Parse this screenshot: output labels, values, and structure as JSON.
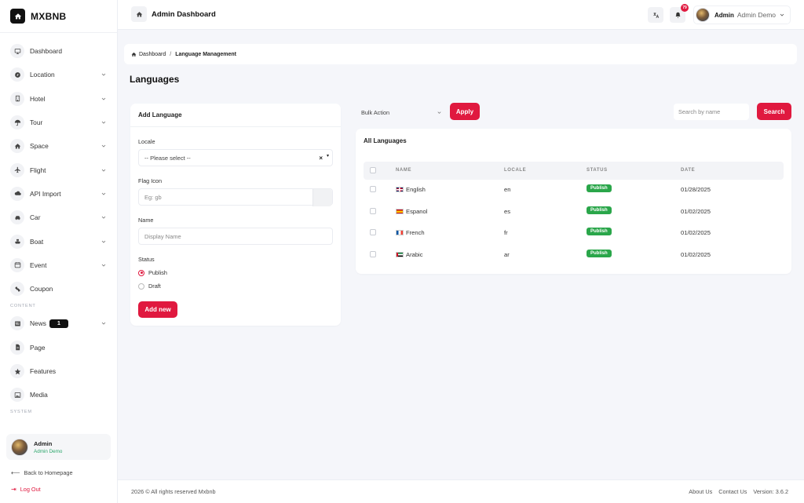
{
  "app": {
    "name": "MXBNB",
    "page_heading": "Admin Dashboard"
  },
  "sidebar": {
    "items": [
      {
        "label": "Dashboard",
        "icon": "monitor-icon",
        "has_sub": false
      },
      {
        "label": "Location",
        "icon": "compass-icon",
        "has_sub": true
      },
      {
        "label": "Hotel",
        "icon": "building-icon",
        "has_sub": true
      },
      {
        "label": "Tour",
        "icon": "umbrella-icon",
        "has_sub": true
      },
      {
        "label": "Space",
        "icon": "home-icon",
        "has_sub": true
      },
      {
        "label": "Flight",
        "icon": "plane-icon",
        "has_sub": true
      },
      {
        "label": "API Import",
        "icon": "cloud-icon",
        "has_sub": true
      },
      {
        "label": "Car",
        "icon": "car-icon",
        "has_sub": true
      },
      {
        "label": "Boat",
        "icon": "ship-icon",
        "has_sub": true
      },
      {
        "label": "Event",
        "icon": "calendar-icon",
        "has_sub": true
      },
      {
        "label": "Coupon",
        "icon": "ticket-icon",
        "has_sub": false
      }
    ],
    "content_section": "CONTENT",
    "content_items": [
      {
        "label": "News",
        "icon": "newspaper-icon",
        "has_sub": true,
        "badge": "1"
      },
      {
        "label": "Page",
        "icon": "file-icon",
        "has_sub": false
      },
      {
        "label": "Features",
        "icon": "star-icon",
        "has_sub": false
      },
      {
        "label": "Media",
        "icon": "image-icon",
        "has_sub": false
      }
    ],
    "system_section": "SYSTEM",
    "user": {
      "name": "Admin",
      "role": "Admin Demo"
    },
    "back_link": "Back to Homepage",
    "logout": "Log Out"
  },
  "topbar": {
    "notification_count": "79",
    "user_name": "Admin",
    "user_role": "Admin Demo"
  },
  "breadcrumb": {
    "root": "Dashboard",
    "current": "Language Management"
  },
  "page_title": "Languages",
  "form": {
    "title": "Add Language",
    "locale_label": "Locale",
    "locale_placeholder": "-- Please select --",
    "flag_label": "Flag Icon",
    "flag_placeholder": "Eg: gb",
    "name_label": "Name",
    "name_placeholder": "Display Name",
    "status_label": "Status",
    "status_options": [
      "Publish",
      "Draft"
    ],
    "status_selected": "Publish",
    "submit_label": "Add new"
  },
  "toolbar": {
    "bulk_action": "Bulk Action",
    "apply_label": "Apply",
    "search_placeholder": "Search by name",
    "search_label": "Search"
  },
  "table": {
    "title": "All Languages",
    "columns": [
      "NAME",
      "LOCALE",
      "STATUS",
      "DATE"
    ],
    "rows": [
      {
        "name": "English",
        "flag": "gb",
        "locale": "en",
        "status": "Publish",
        "date": "01/28/2025"
      },
      {
        "name": "Espanol",
        "flag": "es",
        "locale": "es",
        "status": "Publish",
        "date": "01/02/2025"
      },
      {
        "name": "French",
        "flag": "fr",
        "locale": "fr",
        "status": "Publish",
        "date": "01/02/2025"
      },
      {
        "name": "Arabic",
        "flag": "ae",
        "locale": "ar",
        "status": "Publish",
        "date": "01/02/2025"
      }
    ]
  },
  "footer": {
    "copyright": "2026 © All rights reserved Mxbnb",
    "links": [
      "About Us",
      "Contact Us"
    ],
    "version": "Version: 3.6.2"
  },
  "colors": {
    "accent": "#e0193f",
    "publish": "#2aa64a",
    "dark": "#111111"
  }
}
